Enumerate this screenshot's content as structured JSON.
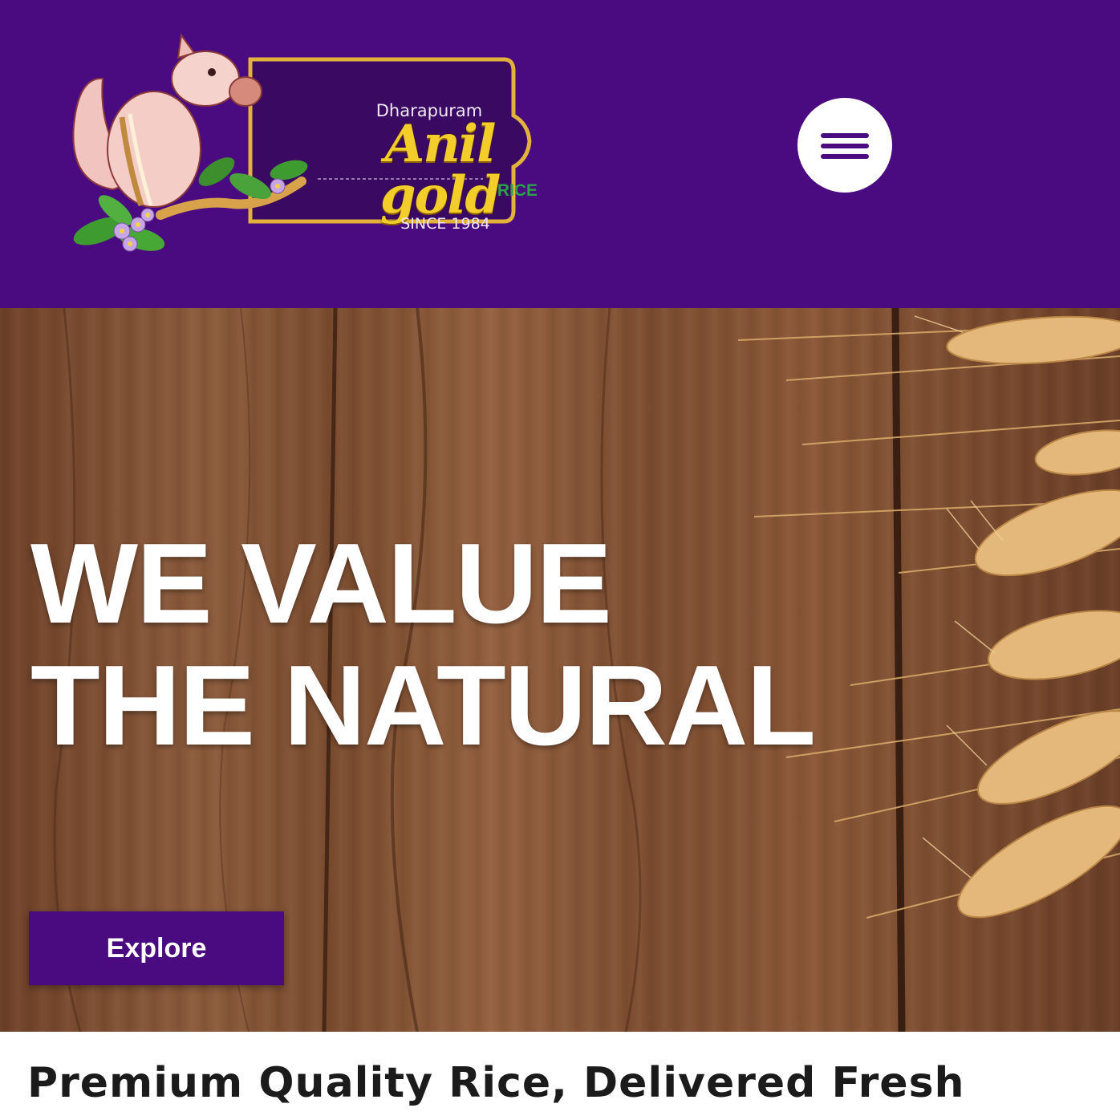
{
  "header": {
    "logo": {
      "place": "Dharapuram",
      "name": "Anil gold",
      "product": "RICE",
      "since": "SINCE 1984"
    },
    "menu_icon": "hamburger-menu-icon"
  },
  "hero": {
    "line1": "WE VALUE",
    "line2": "THE NATURAL",
    "explore_label": "Explore"
  },
  "section": {
    "title": "Premium Quality Rice, Delivered Fresh"
  },
  "colors": {
    "brand_purple": "#4a0a80",
    "gold": "#f3cd2a",
    "rice_green": "#2aa34a",
    "wood": "#7f4e31"
  }
}
